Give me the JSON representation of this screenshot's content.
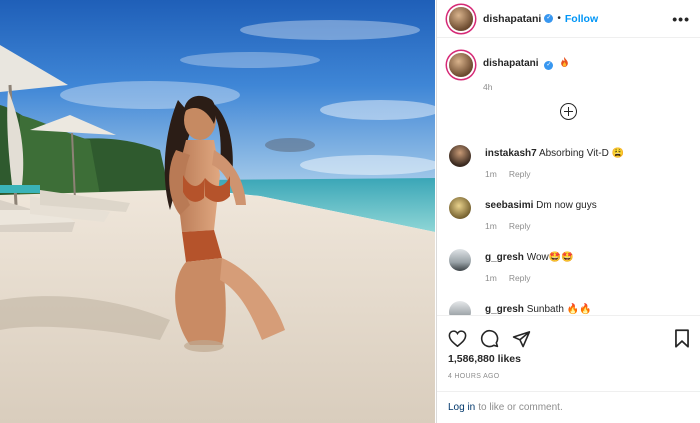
{
  "post": {
    "username": "dishapatani",
    "follow_label": "Follow",
    "separator": "•",
    "more_label": "•••",
    "caption_time": "4h",
    "likes": "1,586,880 likes",
    "age": "4 HOURS AGO"
  },
  "comments": [
    {
      "user": "instakash7",
      "text": "Absorbing Vit-D 😩",
      "time": "1m",
      "reply": "Reply"
    },
    {
      "user": "seebasimi",
      "text": "Dm now guys",
      "time": "1m",
      "reply": "Reply"
    },
    {
      "user": "g_gresh",
      "text": "Wow🤩🤩",
      "time": "1m",
      "reply": "Reply"
    },
    {
      "user": "g_gresh",
      "text": "Sunbath 🔥🔥",
      "time": "",
      "reply": ""
    }
  ],
  "login": {
    "link": "Log in",
    "text": "to like or comment."
  },
  "colors": {
    "accent": "#0095f6",
    "muted": "#8e8e8e",
    "verified": "#3897f0"
  },
  "icons": [
    "verified-badge-icon",
    "flame-icon",
    "heart-icon",
    "comment-icon",
    "share-icon",
    "bookmark-icon",
    "plus-circle-icon"
  ]
}
